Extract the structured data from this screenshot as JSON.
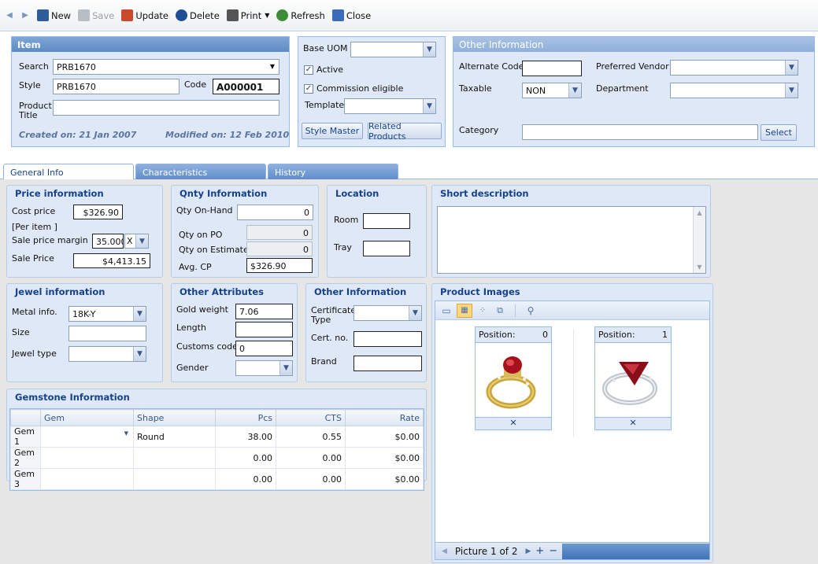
{
  "toolbar": {
    "new": "New",
    "save": "Save",
    "update": "Update",
    "delete": "Delete",
    "print": "Print",
    "refresh": "Refresh",
    "close": "Close"
  },
  "item": {
    "title": "Item",
    "search_label": "Search",
    "search_value": "PRB1670",
    "style_label": "Style",
    "style_value": "PRB1670",
    "code_label": "Code",
    "code_value": "A000001",
    "product_title_label": "Product Title",
    "product_title_value": "",
    "created": "Created on: 21 Jan 2007",
    "modified": "Modified on: 12 Feb 2010"
  },
  "uom": {
    "base_uom_label": "Base UOM",
    "base_uom_value": "",
    "active_label": "Active",
    "active_checked": true,
    "commission_label": "Commission eligible",
    "commission_checked": true,
    "template_label": "Template",
    "template_value": "",
    "style_master": "Style Master",
    "related_products": "Related Products"
  },
  "other_info": {
    "title": "Other Information",
    "alternate_code_label": "Alternate Code",
    "alternate_code_value": "",
    "preferred_vendor_label": "Preferred Vendor",
    "preferred_vendor_value": "",
    "taxable_label": "Taxable",
    "taxable_value": "NON",
    "department_label": "Department",
    "department_value": "",
    "category_label": "Category",
    "category_value": "",
    "select": "Select"
  },
  "tabs": [
    {
      "label": "General Info",
      "active": true
    },
    {
      "label": "Characteristics",
      "active": false
    },
    {
      "label": "History",
      "active": false
    }
  ],
  "price": {
    "title": "Price information",
    "cost_label": "Cost price",
    "cost_value": "$326.90",
    "per_item": "[Per item ]",
    "margin_label": "Sale price margin",
    "margin_value": "35.000",
    "margin_op": "X",
    "sale_label": "Sale Price",
    "sale_value": "$4,413.15"
  },
  "qnty": {
    "title": "Qnty Information",
    "onhand_label": "Qty On-Hand",
    "onhand_value": "0",
    "po_label": "Qty on PO",
    "po_value": "0",
    "estimate_label": "Qty on Estimate",
    "estimate_value": "0",
    "avgcp_label": "Avg. CP",
    "avgcp_value": "$326.90"
  },
  "location": {
    "title": "Location",
    "room_label": "Room",
    "room_value": "",
    "tray_label": "Tray",
    "tray_value": ""
  },
  "short_desc": {
    "title": "Short description",
    "value": ""
  },
  "jewel": {
    "title": "Jewel information",
    "metal_label": "Metal info.",
    "metal_value": "18K-Y",
    "size_label": "Size",
    "size_value": "",
    "type_label": "Jewel type",
    "type_value": ""
  },
  "attrs": {
    "title": "Other Attributes",
    "gold_label": "Gold weight",
    "gold_value": "7.06",
    "length_label": "Length",
    "length_value": "",
    "customs_label": "Customs code",
    "customs_value": "0",
    "gender_label": "Gender",
    "gender_value": ""
  },
  "other_info2": {
    "title": "Other Information",
    "cert_type_label": "Certificate Type",
    "cert_type_value": "",
    "cert_no_label": "Cert. no.",
    "cert_no_value": "",
    "brand_label": "Brand",
    "brand_value": ""
  },
  "gemstone": {
    "title": "Gemstone Information",
    "columns": [
      "",
      "Gem",
      "Shape",
      "Pcs",
      "CTS",
      "Rate"
    ],
    "rows": [
      {
        "label": "Gem 1",
        "gem": "",
        "shape": "Round",
        "pcs": "38.00",
        "cts": "0.55",
        "rate": "$0.00"
      },
      {
        "label": "Gem 2",
        "gem": "",
        "shape": "",
        "pcs": "0.00",
        "cts": "0.00",
        "rate": "$0.00"
      },
      {
        "label": "Gem 3",
        "gem": "",
        "shape": "",
        "pcs": "0.00",
        "cts": "0.00",
        "rate": "$0.00"
      }
    ]
  },
  "images": {
    "title": "Product Images",
    "position_label": "Position:",
    "cards": [
      {
        "position": "0",
        "remove": "✕"
      },
      {
        "position": "1",
        "remove": "✕"
      }
    ],
    "pager": "Picture 1 of 2"
  }
}
